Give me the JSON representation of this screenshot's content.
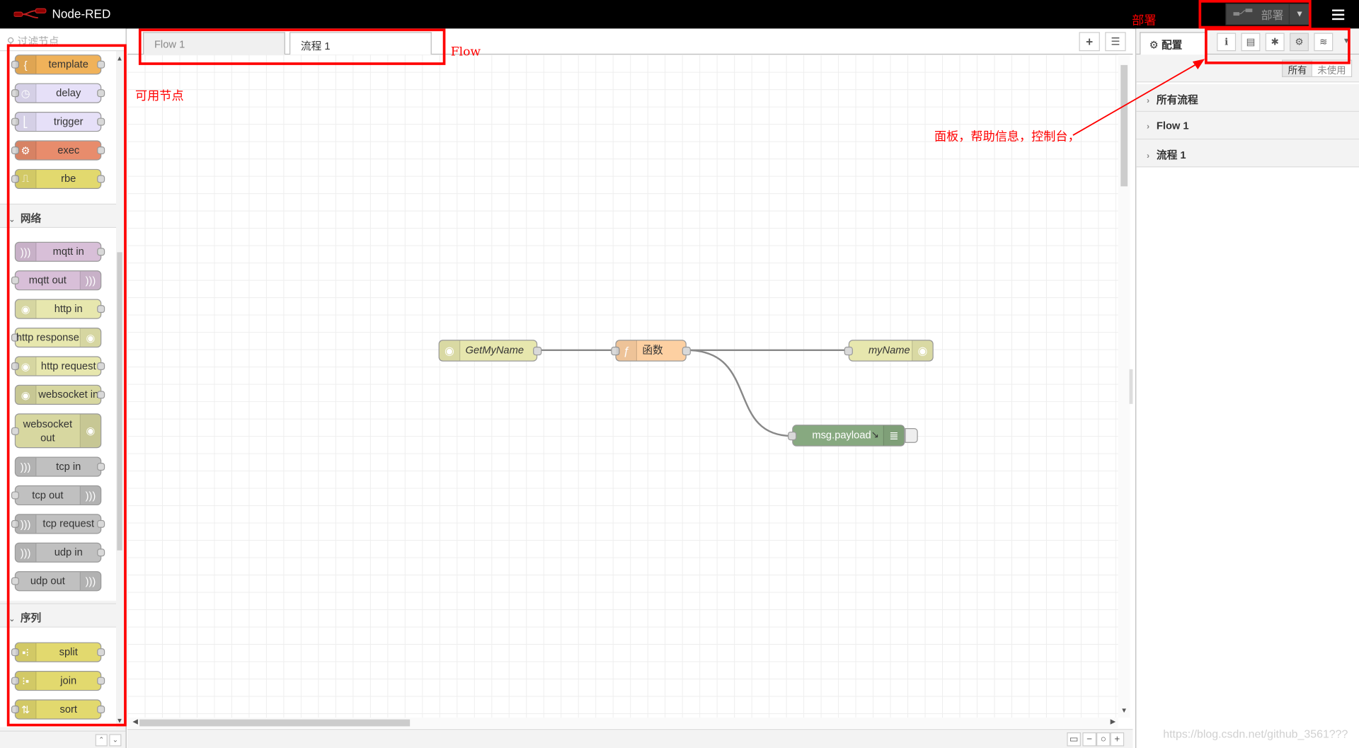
{
  "header": {
    "title": "Node-RED",
    "deploy_label": "部署"
  },
  "palette": {
    "search_placeholder": "过滤节点",
    "top_nodes": [
      {
        "label": "template",
        "color": "#f0b25a",
        "icon": "brace-icon"
      },
      {
        "label": "delay",
        "color": "#e6e0f8",
        "icon": "timer-icon"
      },
      {
        "label": "trigger",
        "color": "#e6e0f8",
        "icon": "trigger-icon"
      },
      {
        "label": "exec",
        "color": "#e88c6c",
        "icon": "cog-icon"
      },
      {
        "label": "rbe",
        "color": "#e2d96e",
        "icon": "rbe-icon"
      }
    ],
    "categories": [
      {
        "name": "网络",
        "nodes": [
          {
            "label": "mqtt in",
            "color": "#d8bfd8"
          },
          {
            "label": "mqtt out",
            "color": "#d8bfd8"
          },
          {
            "label": "http in",
            "color": "#e7e7ae"
          },
          {
            "label": "http response",
            "color": "#e7e7ae"
          },
          {
            "label": "http request",
            "color": "#e7e7ae"
          },
          {
            "label": "websocket in",
            "color": "#d7d7a0"
          },
          {
            "label": "websocket out",
            "color": "#d7d7a0"
          },
          {
            "label": "tcp in",
            "color": "#c0c0c0"
          },
          {
            "label": "tcp out",
            "color": "#c0c0c0"
          },
          {
            "label": "tcp request",
            "color": "#c0c0c0"
          },
          {
            "label": "udp in",
            "color": "#c0c0c0"
          },
          {
            "label": "udp out",
            "color": "#c0c0c0"
          }
        ]
      },
      {
        "name": "序列",
        "nodes": [
          {
            "label": "split",
            "color": "#e2d96e"
          },
          {
            "label": "join",
            "color": "#e2d96e"
          },
          {
            "label": "sort",
            "color": "#e2d96e"
          }
        ]
      }
    ]
  },
  "workspace": {
    "tabs": [
      {
        "label": "Flow 1"
      },
      {
        "label": "流程 1"
      }
    ],
    "add_tab_icon": "plus-icon",
    "list_tabs_icon": "list-icon"
  },
  "flow": {
    "nodes": [
      {
        "id": "getmyname",
        "label": "GetMyName",
        "type": "http in",
        "color": "#e7e7ae"
      },
      {
        "id": "func",
        "label": "函数",
        "type": "function",
        "color": "#fdd0a2"
      },
      {
        "id": "myname",
        "label": "myName",
        "type": "http response",
        "color": "#e7e7ae"
      },
      {
        "id": "debug",
        "label": "msg.payload",
        "type": "debug",
        "color": "#87a980"
      }
    ]
  },
  "sidebar": {
    "active_tab": "配置",
    "icon_buttons": [
      "info-icon",
      "book-icon",
      "bug-icon",
      "gear-icon",
      "database-icon"
    ],
    "filters": [
      "所有",
      "未使用"
    ],
    "rows": [
      "所有流程",
      "Flow 1",
      "流程 1"
    ]
  },
  "annotations": {
    "flow": "Flow",
    "palette": "可用节点",
    "deploy": "部署",
    "sidebar": "面板，帮助信息，控制台，"
  },
  "watermark": "https://blog.csdn.net/github_3561???"
}
